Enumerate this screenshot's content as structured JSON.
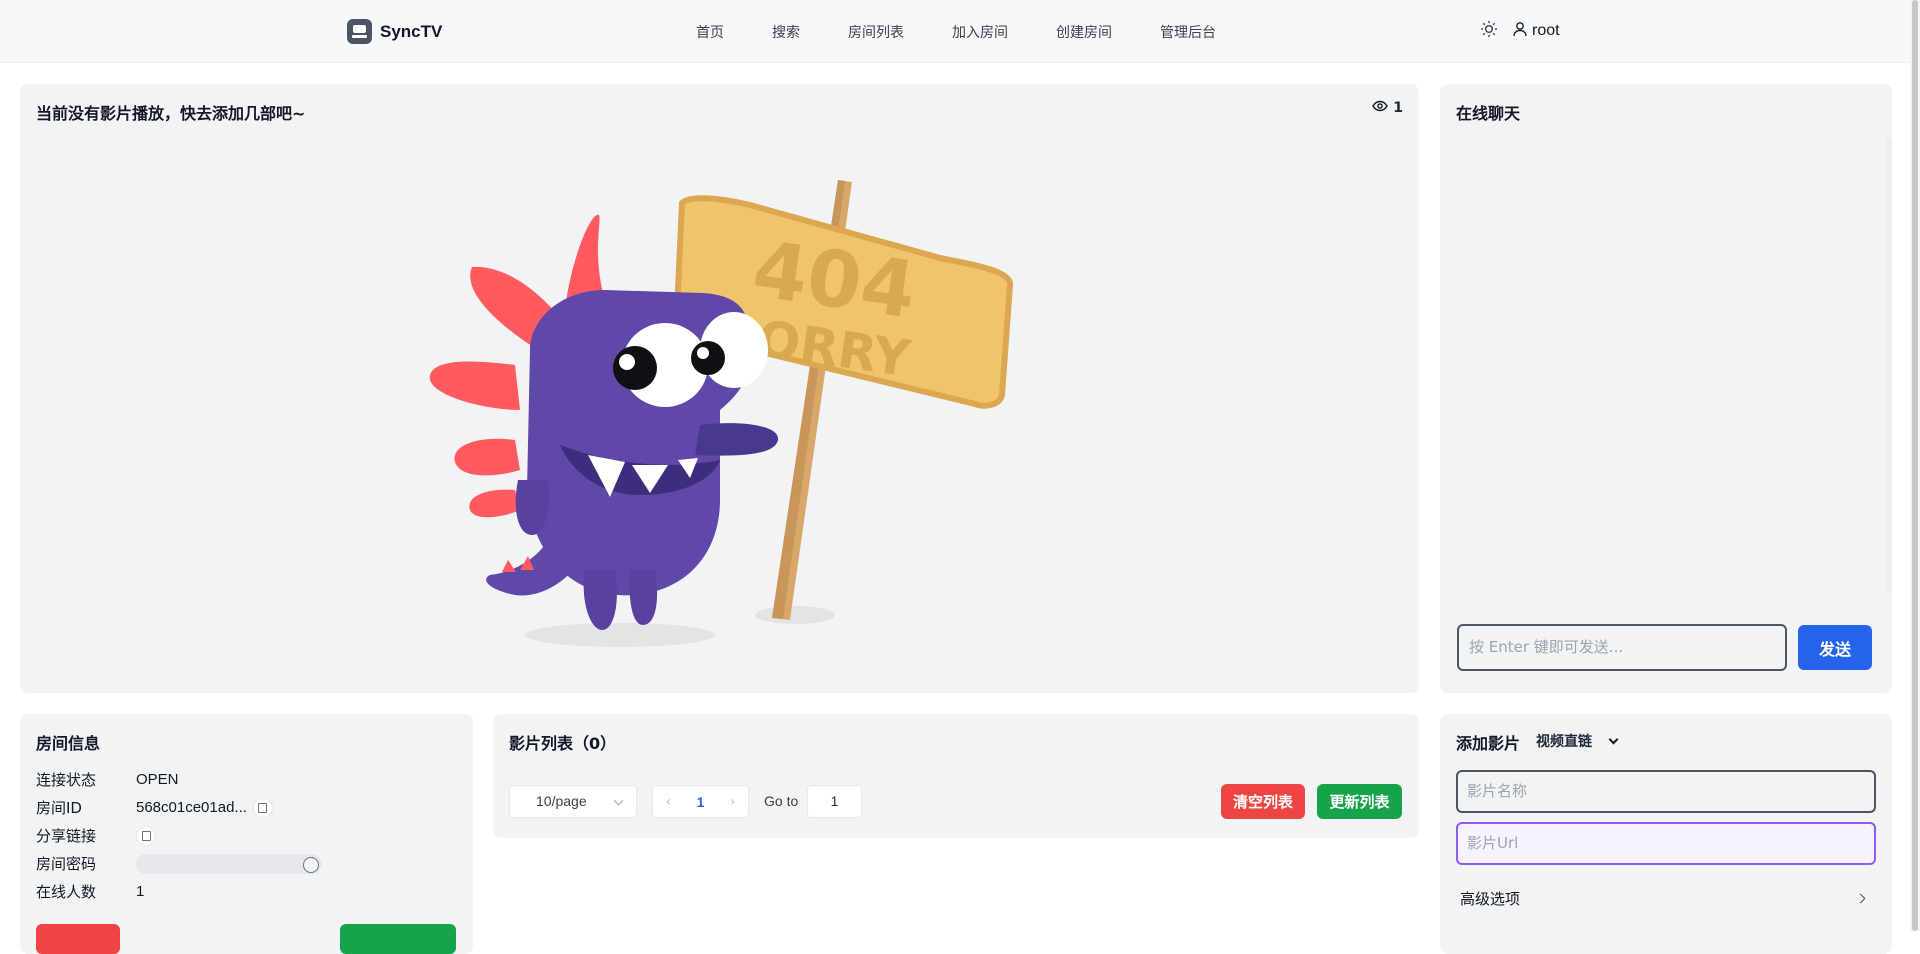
{
  "nav": {
    "brand": "SyncTV",
    "links": [
      "首页",
      "搜索",
      "房间列表",
      "加入房间",
      "创建房间",
      "管理后台"
    ],
    "username": "root"
  },
  "player": {
    "title": "当前没有影片播放，快去添加几部吧~",
    "viewer_count": "1",
    "illustration": {
      "sign_number": "404",
      "sign_text": "SORRY"
    }
  },
  "chat": {
    "title": "在线聊天",
    "input_placeholder": "按 Enter 键即可发送...",
    "send_label": "发送"
  },
  "room_info": {
    "title": "房间信息",
    "rows": [
      {
        "key": "连接状态",
        "value": "OPEN"
      },
      {
        "key": "房间ID",
        "value": "568c01ce01ad..."
      },
      {
        "key": "分享链接",
        "value": ""
      },
      {
        "key": "房间密码",
        "value": ""
      },
      {
        "key": "在线人数",
        "value": "1"
      }
    ]
  },
  "movie_list": {
    "title": "影片列表（0）",
    "page_size": "10/page",
    "current_page": "1",
    "goto_label": "Go to",
    "goto_value": "1",
    "clear_label": "清空列表",
    "update_label": "更新列表"
  },
  "add_movie": {
    "title": "添加影片",
    "mode": "视频直链",
    "name_placeholder": "影片名称",
    "url_placeholder": "影片Url",
    "advanced_label": "高级选项"
  },
  "colors": {
    "primary": "#2563eb",
    "danger": "#ef4444",
    "success": "#16a34a",
    "url_focus": "#8b5cf6",
    "monster": "#6048a8",
    "spikes": "#ff5a5f",
    "sign": "#f0c46a"
  }
}
